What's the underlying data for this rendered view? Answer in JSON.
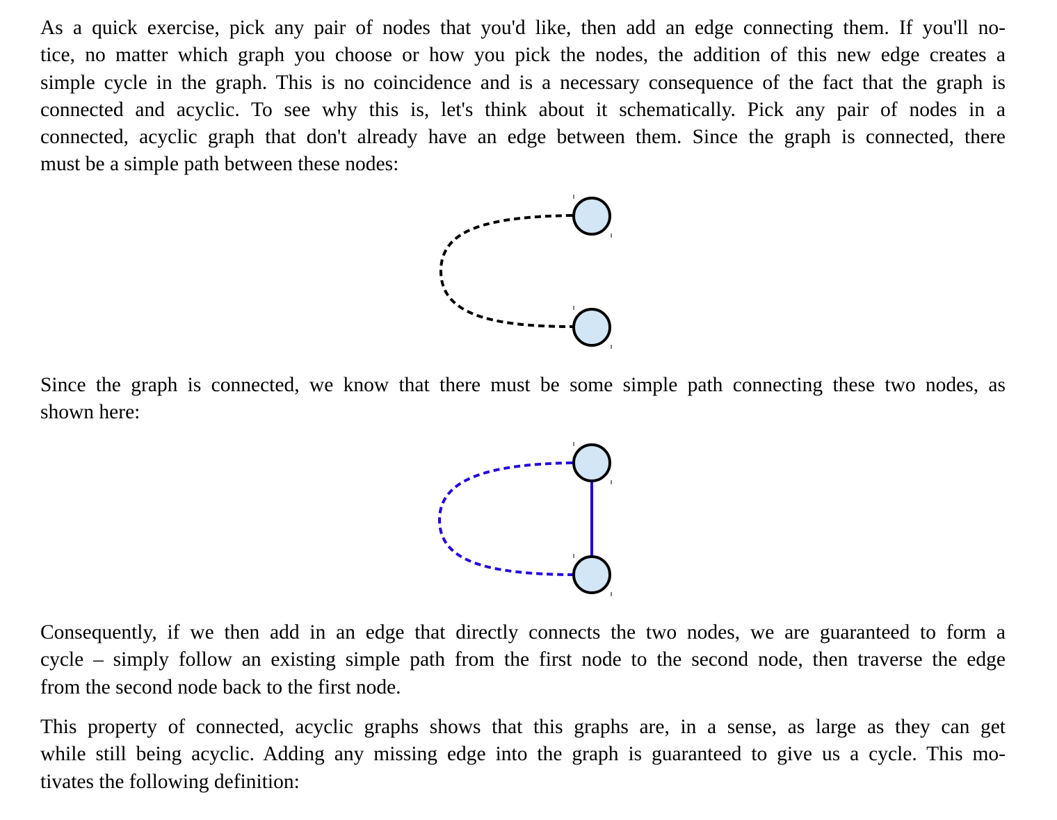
{
  "paragraphs": {
    "p1": [
      "As a quick exercise, pick any pair of nodes that you'd like, then add an edge connecting them. If you'll no-",
      "tice, no matter which graph you choose or how you pick the nodes, the addition of this new edge creates a",
      "simple cycle in the graph. This is no coincidence and is a necessary consequence of the fact that the graph is",
      "connected and acyclic. To see why this is, let's think about it schematically. Pick any pair of nodes in a",
      "connected, acyclic graph that don't already have an edge between them. Since the graph is connected, there",
      "must be a simple path between these nodes:"
    ],
    "p2": [
      "Since the graph is connected, we know that there must be some simple path connecting these two nodes, as",
      "shown here:"
    ],
    "p3": [
      "Consequently, if we then add in an edge that directly connects the two nodes, we are guaranteed to form a",
      "cycle – simply follow an existing simple path from the first node to the second node, then traverse the edge",
      "from the second node back to the first node."
    ],
    "p4": [
      "This property of connected, acyclic graphs shows that this graphs are, in a sense, as large as they can get",
      "while still being acyclic. Adding any missing edge into the graph is guaranteed to give us a cycle. This mo-",
      "tivates the following definition:"
    ]
  },
  "colors": {
    "node_fill": "#d3e6f5",
    "node_stroke": "#000000",
    "path_black": "#000000",
    "path_blue": "#2200dd"
  }
}
